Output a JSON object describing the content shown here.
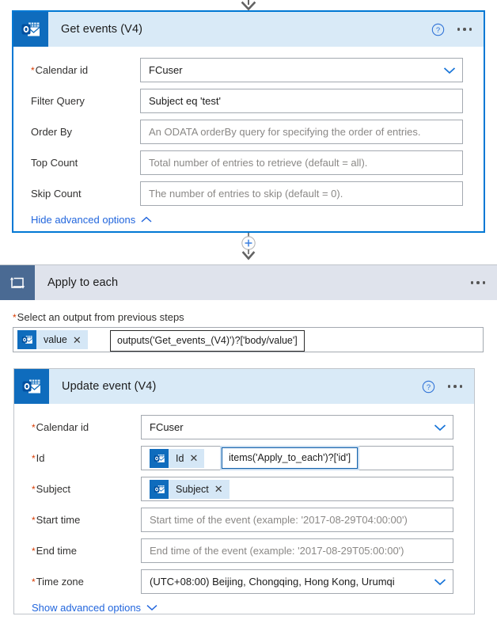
{
  "connectors": {
    "top_arrow": "arrow-down-icon",
    "add_button": "add-step-plus-icon",
    "mid_arrow": "arrow-down-icon"
  },
  "get_events_card": {
    "icon": "outlook-icon",
    "title": "Get events (V4)",
    "help": "help-icon",
    "menu": "more-menu-icon",
    "rows": [
      {
        "label": "Calendar id",
        "required": true,
        "value": "FCuser",
        "placeholder": "",
        "control": "dropdown"
      },
      {
        "label": "Filter Query",
        "required": false,
        "value": "Subject eq 'test'",
        "placeholder": "",
        "control": "text"
      },
      {
        "label": "Order By",
        "required": false,
        "value": "",
        "placeholder": "An ODATA orderBy query for specifying the order of entries.",
        "control": "text"
      },
      {
        "label": "Top Count",
        "required": false,
        "value": "",
        "placeholder": "Total number of entries to retrieve (default = all).",
        "control": "text"
      },
      {
        "label": "Skip Count",
        "required": false,
        "value": "",
        "placeholder": "The number of entries to skip (default = 0).",
        "control": "text"
      }
    ],
    "advanced_link": "Hide advanced options",
    "advanced_chevron": "chevron-up-icon"
  },
  "apply_to_each_card": {
    "icon": "loop-repeat-icon",
    "title": "Apply to each",
    "menu": "more-menu-icon",
    "output_label": "Select an output from previous steps",
    "output_label_required": true,
    "token": {
      "icon": "outlook-icon",
      "text": "value",
      "remove": "remove-token-icon"
    },
    "tooltip": "outputs('Get_events_(V4)')?['body/value']"
  },
  "update_event_card": {
    "icon": "outlook-icon",
    "title": "Update event (V4)",
    "help": "help-icon",
    "menu": "more-menu-icon",
    "rows": [
      {
        "label": "Calendar id",
        "required": true,
        "value": "FCuser",
        "placeholder": "",
        "control": "dropdown"
      },
      {
        "label": "Id",
        "required": true,
        "value": "",
        "placeholder": "",
        "control": "token",
        "token_text": "Id",
        "tooltip": "items('Apply_to_each')?['id']"
      },
      {
        "label": "Subject",
        "required": true,
        "value": "",
        "placeholder": "",
        "control": "token",
        "token_text": "Subject"
      },
      {
        "label": "Start time",
        "required": true,
        "value": "",
        "placeholder": "Start time of the event (example: '2017-08-29T04:00:00')",
        "control": "text"
      },
      {
        "label": "End time",
        "required": true,
        "value": "",
        "placeholder": "End time of the event (example: '2017-08-29T05:00:00')",
        "control": "text"
      },
      {
        "label": "Time zone",
        "required": true,
        "value": "(UTC+08:00) Beijing, Chongqing, Hong Kong, Urumqi",
        "placeholder": "",
        "control": "dropdown"
      }
    ],
    "advanced_link": "Show advanced options",
    "advanced_chevron": "chevron-down-icon"
  },
  "colors": {
    "accent": "#0078d4",
    "header_blue": "#d9eaf7",
    "header_grey": "#dfe3ec",
    "outlook_blue": "#0f6cbd",
    "loop_slate": "#4a6a93",
    "link_blue": "#2266dd",
    "required_red": "#d83b01"
  }
}
